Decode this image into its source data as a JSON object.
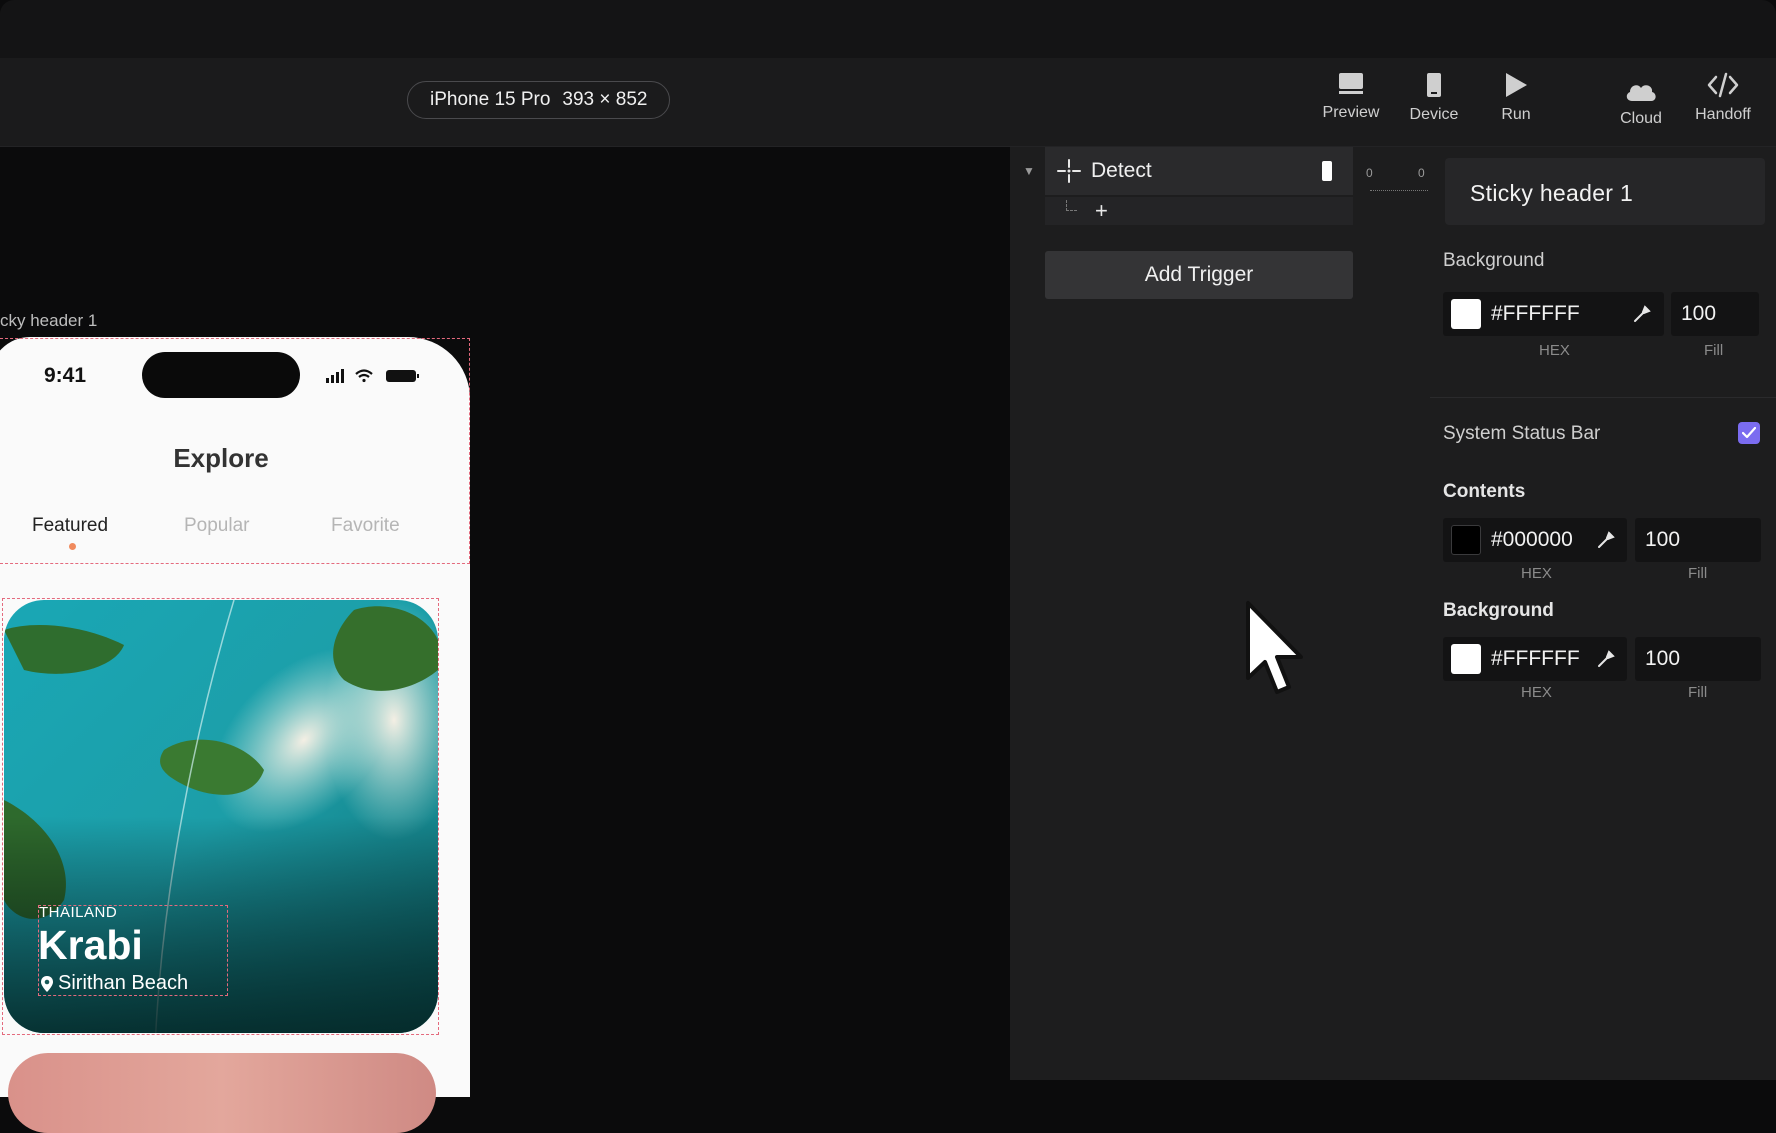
{
  "toolbar": {
    "device": "iPhone 15 Pro",
    "device_size": "393 × 852",
    "tools": [
      {
        "label": "Preview",
        "icon": "preview-icon"
      },
      {
        "label": "Device",
        "icon": "device-icon"
      },
      {
        "label": "Run",
        "icon": "play-icon"
      },
      {
        "label": "Cloud",
        "icon": "cloud-icon"
      },
      {
        "label": "Handoff",
        "icon": "code-icon"
      }
    ]
  },
  "canvas": {
    "frame_label": "cky header 1",
    "phone": {
      "time": "9:41",
      "title": "Explore",
      "tabs": [
        "Featured",
        "Popular",
        "Favorite"
      ],
      "active_tab": "Featured",
      "card": {
        "country": "THAILAND",
        "title": "Krabi",
        "subtitle": "Sirithan Beach"
      }
    }
  },
  "interactions": {
    "trigger_label": "Detect",
    "add_trigger_label": "Add Trigger",
    "timeline_start": "0",
    "timeline_end": "0"
  },
  "inspector": {
    "title": "Sticky header 1",
    "background_label": "Background",
    "background_hex": "#FFFFFF",
    "background_fill": "100",
    "hex_caption": "HEX",
    "fill_caption": "Fill",
    "status_bar_label": "System Status Bar",
    "status_bar_checked": true,
    "contents_label": "Contents",
    "contents_hex": "#000000",
    "contents_fill": "100",
    "status_bg_label": "Background",
    "status_bg_hex": "#FFFFFF",
    "status_bg_fill": "100"
  },
  "colors": {
    "accent": "#7B6CF0",
    "selection_outline": "#E46A7D",
    "tab_dot": "#F08A5D"
  }
}
